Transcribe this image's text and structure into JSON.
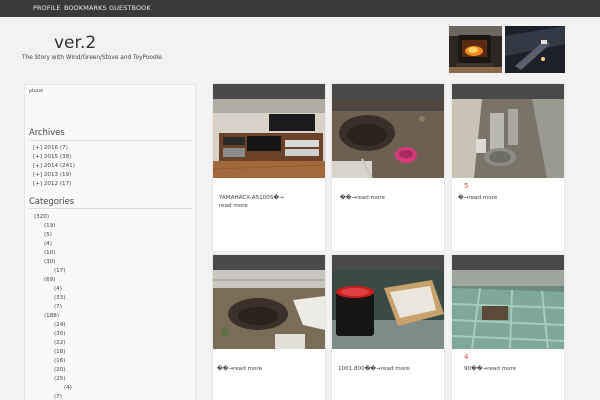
{
  "nav": {
    "items": [
      "PROFILE",
      "BOOKMARKS",
      "GUESTBOOK"
    ]
  },
  "site": {
    "title": "ver.2",
    "description": "The Story with Wind/Green/Stove and ToyPoodle"
  },
  "sidebar": {
    "note": "ptszvt",
    "archives": {
      "heading": "Archives",
      "items": [
        "[+] 2016 (7)",
        "[+] 2015 (38)",
        "[+] 2014 (241)",
        "[+] 2013 (19)",
        "[+] 2012 (17)"
      ]
    },
    "categories": {
      "heading": "Categories",
      "items": [
        "(320)",
        "(19)",
        "(5)",
        "(4)",
        "(10)",
        "(30)",
        "(17)",
        "(69)",
        "(4)",
        "(33)",
        "(7)",
        "(188)",
        "(24)",
        "(30)",
        "(22)",
        "(18)",
        "(16)",
        "(20)",
        "(25)",
        "(4)",
        "(7)"
      ]
    }
  },
  "posts": [
    {
      "number": "",
      "line1": "YAMAHACX-A5100S�→",
      "line2": "read more"
    },
    {
      "number": "",
      "line1": "��→read more",
      "line2": ""
    },
    {
      "number": "5",
      "line1": "�→read more",
      "line2": ""
    },
    {
      "number": "",
      "line1": "��→read more",
      "line2": ""
    },
    {
      "number": "",
      "line1": "1001,800��→read more",
      "line2": ""
    },
    {
      "number": "4",
      "line1": "90��→read more",
      "line2": ""
    }
  ],
  "icons": [
    "stove-photo",
    "stove-night-photo",
    "tv-cabinet-photo",
    "dirt-hole-photo",
    "garden-stones-photo",
    "garden-hole-photo",
    "paint-box-photo",
    "tile-garden-photo"
  ],
  "colors": {
    "nav_bg": "#3a3a3a",
    "card_bar": "#4a4a4a",
    "accent_number": "#e04040",
    "page_bg": "#f2f2f2"
  }
}
